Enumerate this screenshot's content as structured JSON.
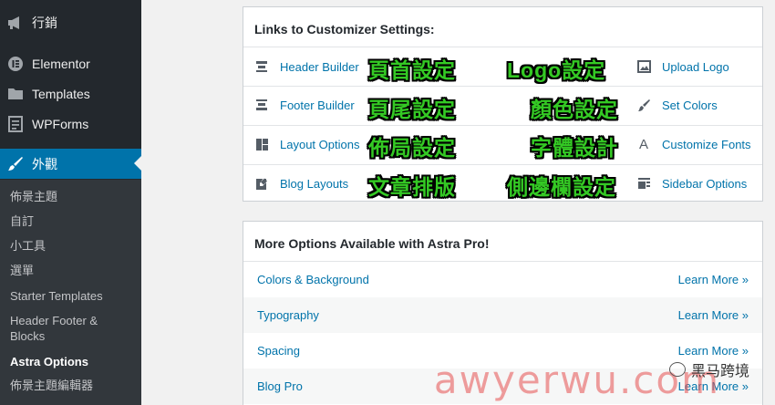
{
  "sidebar": {
    "menu": [
      {
        "label": "行銷",
        "icon": "megaphone-icon"
      },
      {
        "label": "Elementor",
        "icon": "elementor-icon"
      },
      {
        "label": "Templates",
        "icon": "folder-icon"
      },
      {
        "label": "WPForms",
        "icon": "form-icon"
      },
      {
        "label": "外觀",
        "icon": "paintbrush-icon"
      }
    ],
    "submenu": [
      "佈景主題",
      "自訂",
      "小工具",
      "選單",
      "Starter Templates",
      "Header Footer & Blocks",
      "Astra Options",
      "佈景主題編輯器"
    ]
  },
  "customizer_panel": {
    "title": "Links to Customizer Settings:",
    "left_links": [
      {
        "label": "Header Builder",
        "icon": "header-builder-icon",
        "annotation": "頁首設定"
      },
      {
        "label": "Footer Builder",
        "icon": "footer-builder-icon",
        "annotation": "頁尾設定"
      },
      {
        "label": "Layout Options",
        "icon": "layout-icon",
        "annotation": "佈局設定"
      },
      {
        "label": "Blog Layouts",
        "icon": "edit-page-icon",
        "annotation": "文章排版"
      }
    ],
    "right_links": [
      {
        "label": "Upload Logo",
        "icon": "image-icon",
        "annotation": "Logo設定"
      },
      {
        "label": "Set Colors",
        "icon": "brush-icon",
        "annotation": "顏色設定"
      },
      {
        "label": "Customize Fonts",
        "icon": "font-icon",
        "annotation": "字體設計"
      },
      {
        "label": "Sidebar Options",
        "icon": "sidebar-icon",
        "annotation": "側邊欄設定"
      }
    ]
  },
  "pro_panel": {
    "title": "More Options Available with Astra Pro!",
    "rows": [
      {
        "label": "Colors & Background",
        "action": "Learn More »"
      },
      {
        "label": "Typography",
        "action": "Learn More »"
      },
      {
        "label": "Spacing",
        "action": "Learn More »"
      },
      {
        "label": "Blog Pro",
        "action": "Learn More »"
      }
    ]
  },
  "watermark": {
    "label": "黑马跨境",
    "site": "awyerwu.com"
  },
  "colors": {
    "sidebar": "#23282d",
    "accent": "#0073aa",
    "annotation": "#34c924"
  }
}
